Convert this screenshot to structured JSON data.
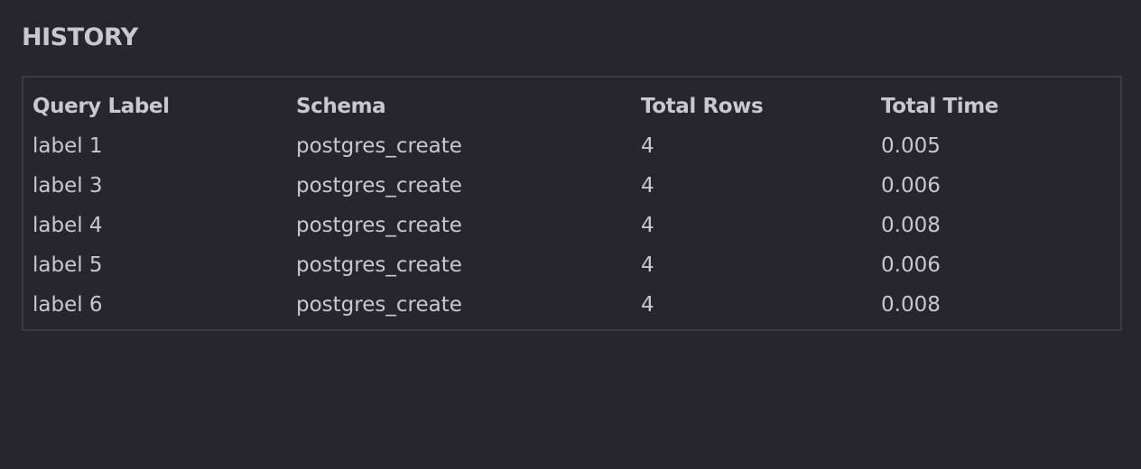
{
  "history": {
    "title": "HISTORY",
    "columns": [
      "Query Label",
      "Schema",
      "Total Rows",
      "Total Time"
    ],
    "rows": [
      {
        "label": "label 1",
        "schema": "postgres_create",
        "total_rows": "4",
        "total_time": "0.005"
      },
      {
        "label": "label 3",
        "schema": "postgres_create",
        "total_rows": "4",
        "total_time": "0.006"
      },
      {
        "label": "label 4",
        "schema": "postgres_create",
        "total_rows": "4",
        "total_time": "0.008"
      },
      {
        "label": "label 5",
        "schema": "postgres_create",
        "total_rows": "4",
        "total_time": "0.006"
      },
      {
        "label": "label 6",
        "schema": "postgres_create",
        "total_rows": "4",
        "total_time": "0.008"
      }
    ]
  }
}
